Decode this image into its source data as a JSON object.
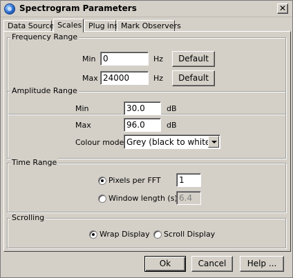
{
  "window": {
    "title": "Spectrogram Parameters",
    "close_glyph": "✕"
  },
  "tabs": [
    {
      "label": "Data Source",
      "active": false
    },
    {
      "label": "Scales",
      "active": true
    },
    {
      "label": "Plug ins",
      "active": false
    },
    {
      "label": "Mark Observers",
      "active": false
    }
  ],
  "frequency_range": {
    "title": "Frequency Range",
    "min_label": "Min",
    "min_value": "0",
    "min_unit": "Hz",
    "max_label": "Max",
    "max_value": "24000",
    "max_unit": "Hz",
    "default_label": "Default"
  },
  "amplitude_range": {
    "title": "Amplitude Range",
    "min_label": "Min",
    "min_value": "30.0",
    "min_unit": "dB",
    "max_label": "Max",
    "max_value": "96.0",
    "max_unit": "dB",
    "colour_label": "Colour model",
    "colour_value": "Grey (black to white)"
  },
  "time_range": {
    "title": "Time Range",
    "pixels_label": "Pixels per FFT",
    "pixels_value": "1",
    "pixels_checked": true,
    "window_label": "Window length (s)",
    "window_value": "6.4",
    "window_checked": false
  },
  "scrolling": {
    "title": "Scrolling",
    "wrap_label": "Wrap Display",
    "wrap_checked": true,
    "scroll_label": "Scroll Display",
    "scroll_checked": false
  },
  "footer": {
    "ok_label": "Ok",
    "cancel_label": "Cancel",
    "help_label": "Help ..."
  }
}
